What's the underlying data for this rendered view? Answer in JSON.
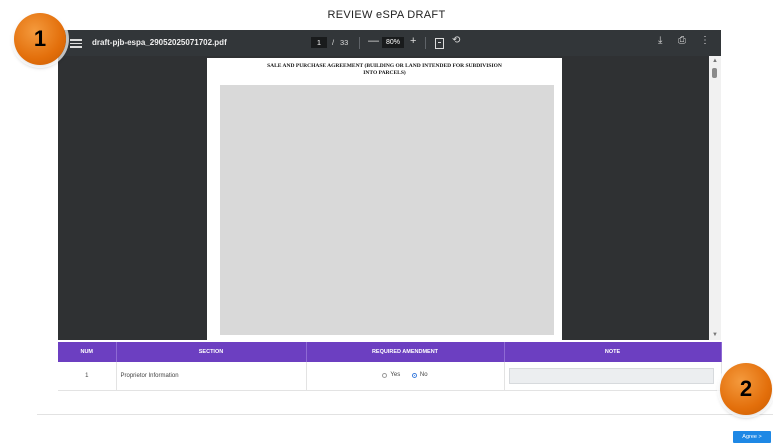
{
  "page": {
    "title": "REVIEW eSPA DRAFT"
  },
  "pdf_toolbar": {
    "filename": "draft-pjb-espa_29052025071702.pdf",
    "current_page": "1",
    "page_separator": "/",
    "total_pages": "33",
    "zoom": "80%",
    "zoom_out_symbol": "—",
    "zoom_in_symbol": "+",
    "icons": [
      "menu-icon",
      "zoom-out-icon",
      "zoom-in-icon",
      "fit-page-icon",
      "rotate-icon",
      "download-icon",
      "print-icon",
      "more-vert-icon"
    ]
  },
  "pdf_page": {
    "heading_line1": "SALE AND PURCHASE AGREEMENT (BUILDING OR LAND INTENDED FOR SUBDIVISION",
    "heading_line2": "INTO PARCELS)"
  },
  "table": {
    "headers": {
      "num": "NUM",
      "section": "SECTION",
      "amendment": "REQUIRED AMENDMENT",
      "note": "NOTE"
    },
    "rows": [
      {
        "num": "1",
        "section": "Proprietor Information",
        "yes_label": "Yes",
        "no_label": "No",
        "selected": "No",
        "note": ""
      }
    ]
  },
  "actions": {
    "agree_label": "Agree >"
  },
  "callouts": {
    "one": "1",
    "two": "2"
  },
  "colors": {
    "table_header": "#6c3fc1",
    "agree_button": "#1e88e5",
    "callout": "#e36f0b",
    "pdf_toolbar": "#323639"
  }
}
